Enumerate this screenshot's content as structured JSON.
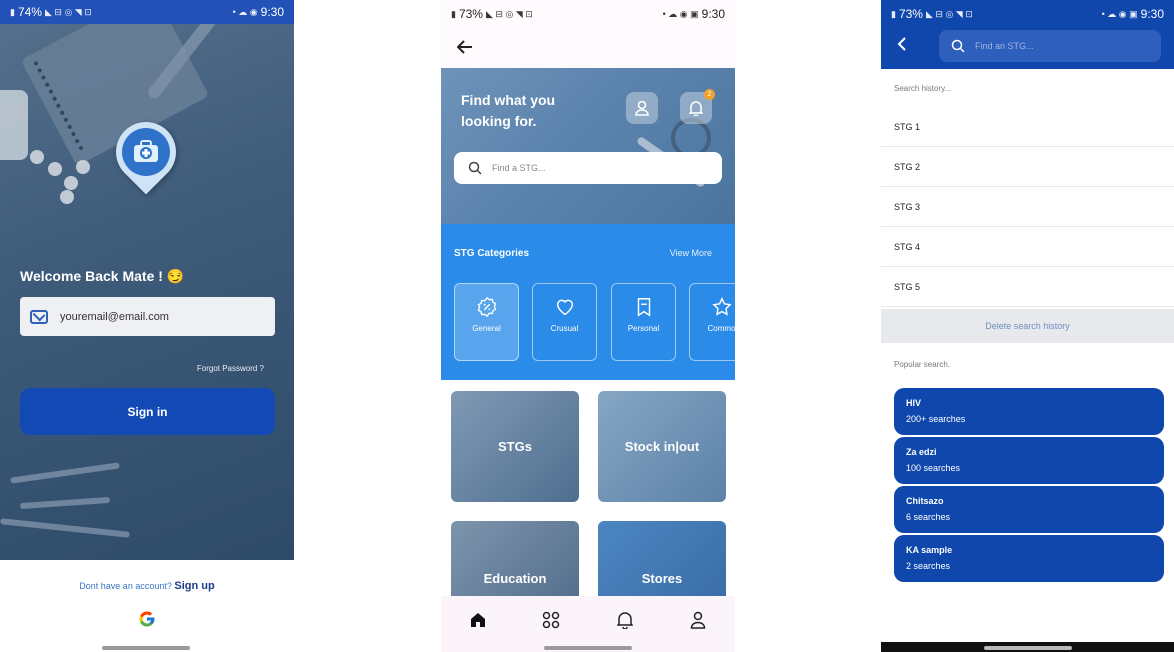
{
  "login": {
    "status": {
      "battery": "74%",
      "time": "9:30"
    },
    "welcome": "Welcome Back Mate ! 😏",
    "email_placeholder": "youremail@email.com",
    "forgot": "Forgot Password ?",
    "signin": "Sign in",
    "no_account": "Dont have an account?",
    "signup": "Sign up",
    "google": "G"
  },
  "home": {
    "status": {
      "battery": "73%",
      "time": "9:30"
    },
    "hero_title": "Find what you looking for.",
    "notification_count": "2",
    "search_placeholder": "Find a STG...",
    "categories_title": "STG Categories",
    "view_more": "View More",
    "categories": [
      {
        "label": "General",
        "selected": true
      },
      {
        "label": "Crusual",
        "selected": false
      },
      {
        "label": "Personal",
        "selected": false
      },
      {
        "label": "Commo",
        "selected": false
      }
    ],
    "tiles": [
      "STGs",
      "Stock in|out",
      "Education",
      "Stores"
    ]
  },
  "search": {
    "status": {
      "battery": "73%",
      "time": "9:30"
    },
    "placeholder": "Find an STG...",
    "history_label": "Search history...",
    "history": [
      "STG 1",
      "STG 2",
      "STG 3",
      "STG 4",
      "STG 5"
    ],
    "delete_label": "Delete search history",
    "popular_label": "Popular search.",
    "popular": [
      {
        "title": "HIV",
        "count": "200+ searches"
      },
      {
        "title": "Za edzi",
        "count": "100 searches"
      },
      {
        "title": "Chitsazo",
        "count": "6 searches"
      },
      {
        "title": "KA sample",
        "count": "2 searches"
      }
    ]
  },
  "colors": {
    "primary": "#0f47ad",
    "accent": "#2a8be8",
    "badge": "#f2a12a"
  }
}
